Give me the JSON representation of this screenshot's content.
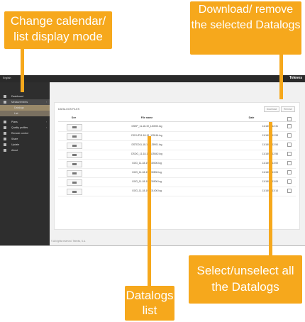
{
  "topbar": {
    "language": "English",
    "brand": "Televes"
  },
  "sidebar": {
    "items": [
      {
        "label": "Dashboard",
        "arrow": ""
      },
      {
        "label": "Measurements",
        "arrow": "‹"
      },
      {
        "label": "Datalogs",
        "arrow": ""
      },
      {
        "label": "List",
        "arrow": ""
      },
      {
        "label": "Plans",
        "arrow": "‹"
      },
      {
        "label": "Quality profiles",
        "arrow": "‹"
      },
      {
        "label": "Remote control",
        "arrow": ""
      },
      {
        "label": "Share",
        "arrow": ""
      },
      {
        "label": "Update",
        "arrow": ""
      },
      {
        "label": "About",
        "arrow": ""
      }
    ]
  },
  "panel": {
    "title": "DATALOGS FILES",
    "download_label": "Download",
    "remove_label": "Remove",
    "columns": {
      "see": "See",
      "file": "File name",
      "date": "Date"
    }
  },
  "rows": [
    {
      "file": "DSEP_11-18-19_120000.log",
      "date": "11/18/19 12:31"
    },
    {
      "file": "DSYUP11-18-19_125116.log",
      "date": "11/18/19 12:53"
    },
    {
      "file": "DSTD011-18-19_125901.log",
      "date": "11/18/19 12:54"
    },
    {
      "file": "DSOG_11-18-19_125542.log",
      "date": "11/18/19 12:56"
    },
    {
      "file": "GOG_11-18-19_130000.log",
      "date": "11/18/19 13:00"
    },
    {
      "file": "GOG_11-18-19_130500.log",
      "date": "11/18/19 13:05"
    },
    {
      "file": "GOG_11-18-19_130900.log",
      "date": "11/18/19 13:09"
    },
    {
      "file": "GOG_11-18-19_131400.log",
      "date": "11/18/19 13:14"
    }
  ],
  "footer": "© All rights reserved. Televés, S.A.",
  "callouts": {
    "mode": "Change calendar/ list display mode",
    "download": "Download/ remove the selected Datalogs",
    "select": "Select/unselect all the Datalogs",
    "list": "Datalogs list"
  },
  "colors": {
    "accent": "#f6a81c",
    "sidebar": "#2e2e2e"
  }
}
